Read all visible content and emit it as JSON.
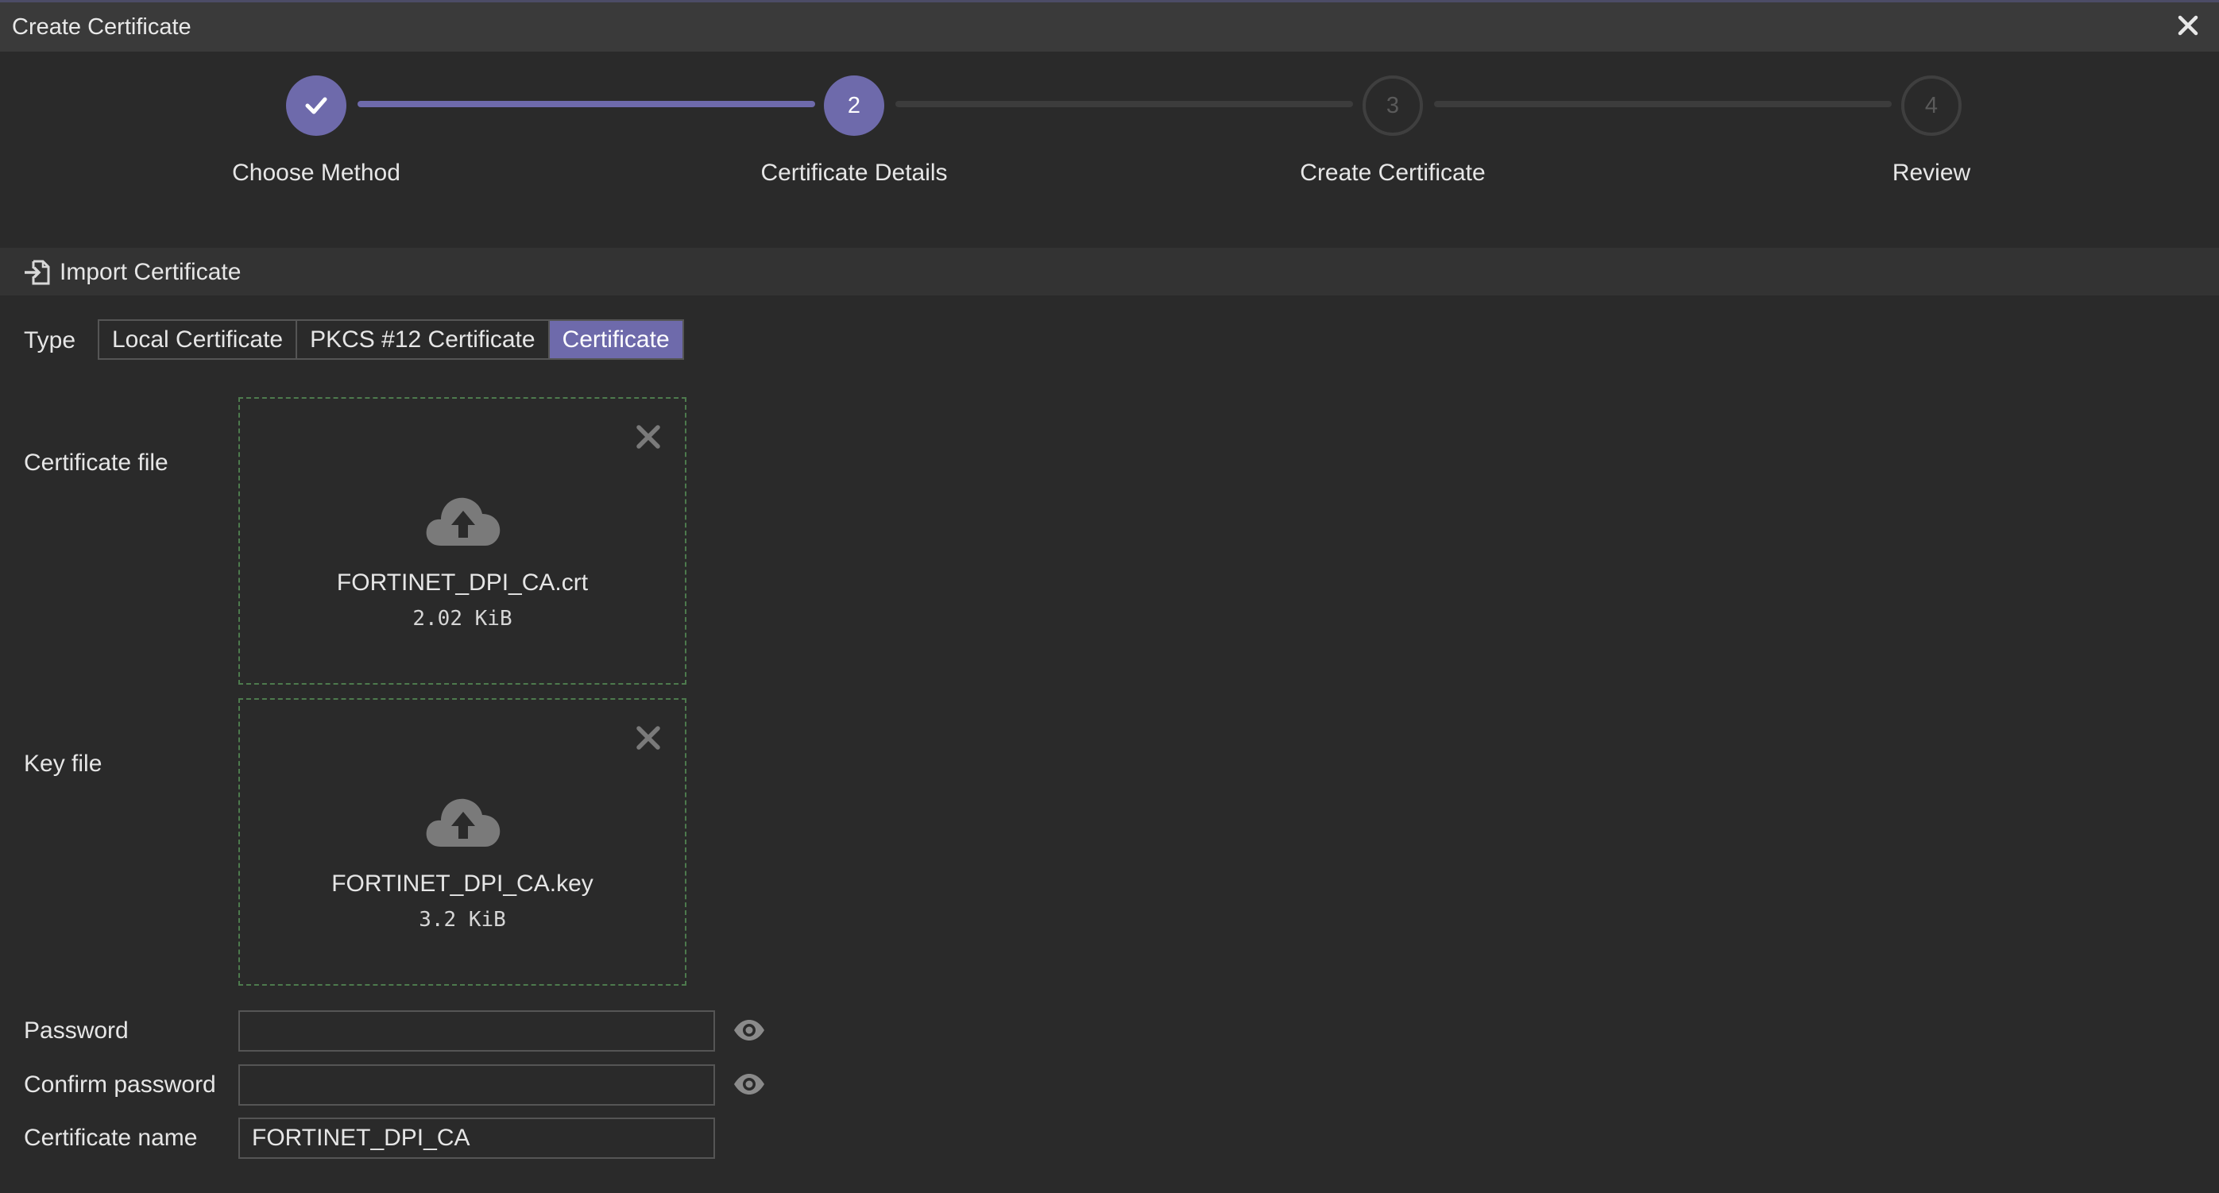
{
  "window": {
    "title": "Create Certificate"
  },
  "wizard": {
    "steps": [
      {
        "number": "1",
        "label": "Choose Method",
        "state": "done"
      },
      {
        "number": "2",
        "label": "Certificate Details",
        "state": "active"
      },
      {
        "number": "3",
        "label": "Create Certificate",
        "state": "todo"
      },
      {
        "number": "4",
        "label": "Review",
        "state": "todo"
      }
    ]
  },
  "section": {
    "title": "Import Certificate",
    "icon": "import-file-icon"
  },
  "type": {
    "label": "Type",
    "options": [
      "Local Certificate",
      "PKCS #12 Certificate",
      "Certificate"
    ],
    "selected": "Certificate"
  },
  "certificate_file": {
    "label": "Certificate file",
    "file_name": "FORTINET_DPI_CA.crt",
    "file_size": "2.02 KiB"
  },
  "key_file": {
    "label": "Key file",
    "file_name": "FORTINET_DPI_CA.key",
    "file_size": "3.2 KiB"
  },
  "password": {
    "label": "Password",
    "value": ""
  },
  "confirm_password": {
    "label": "Confirm password",
    "value": ""
  },
  "certificate_name": {
    "label": "Certificate name",
    "value": "FORTINET_DPI_CA"
  },
  "colors": {
    "accent": "#6e6aab",
    "background": "#2a2a2a",
    "dropzone_border": "#4d7a4d"
  }
}
